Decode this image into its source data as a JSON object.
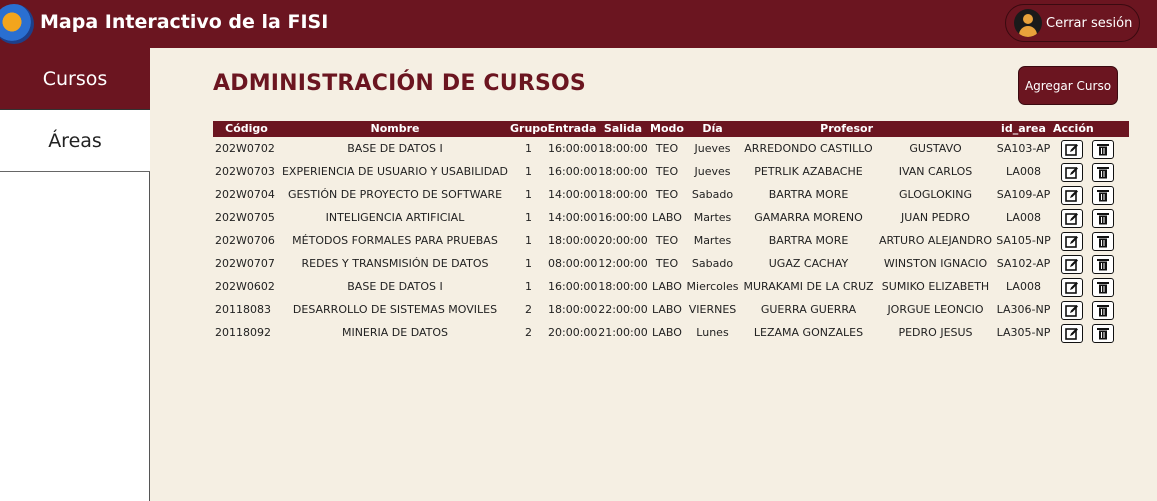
{
  "header": {
    "app_title": "Mapa Interactivo de la FISI",
    "logout_label": "Cerrar sesión"
  },
  "sidebar": {
    "items": [
      {
        "label": "Cursos",
        "active": true
      },
      {
        "label": "Áreas",
        "active": false
      }
    ]
  },
  "main": {
    "title": "ADMINISTRACIÓN DE CURSOS",
    "add_button_label": "Agregar Curso"
  },
  "table": {
    "headers": [
      "Código",
      "Nombre",
      "Grupo",
      "Entrada",
      "Salida",
      "Modo",
      "Día",
      "Profesor",
      "",
      "id_area",
      "Acción"
    ],
    "rows": [
      [
        "202W0702",
        "BASE DE DATOS I",
        "1",
        "16:00:00",
        "18:00:00",
        "TEO",
        "Jueves",
        "ARREDONDO CASTILLO",
        "GUSTAVO",
        "SA103-AP"
      ],
      [
        "202W0703",
        "EXPERIENCIA DE USUARIO Y USABILIDAD",
        "1",
        "16:00:00",
        "18:00:00",
        "TEO",
        "Jueves",
        "PETRLIK AZABACHE",
        "IVAN CARLOS",
        "LA008"
      ],
      [
        "202W0704",
        "GESTIÓN DE PROYECTO DE SOFTWARE",
        "1",
        "14:00:00",
        "18:00:00",
        "TEO",
        "Sabado",
        "BARTRA MORE",
        "GLOGLOKING",
        "SA109-AP"
      ],
      [
        "202W0705",
        "INTELIGENCIA ARTIFICIAL",
        "1",
        "14:00:00",
        "16:00:00",
        "LABO",
        "Martes",
        "GAMARRA MORENO",
        "JUAN PEDRO",
        "LA008"
      ],
      [
        "202W0706",
        "MÉTODOS FORMALES PARA PRUEBAS",
        "1",
        "18:00:00",
        "20:00:00",
        "TEO",
        "Martes",
        "BARTRA MORE",
        "ARTURO ALEJANDRO",
        "SA105-NP"
      ],
      [
        "202W0707",
        "REDES Y TRANSMISIÓN DE DATOS",
        "1",
        "08:00:00",
        "12:00:00",
        "TEO",
        "Sabado",
        "UGAZ CACHAY",
        "WINSTON IGNACIO",
        "SA102-AP"
      ],
      [
        "202W0602",
        "BASE DE DATOS I",
        "1",
        "16:00:00",
        "18:00:00",
        "LABO",
        "Miercoles",
        "MURAKAMI DE LA CRUZ",
        "SUMIKO ELIZABETH",
        "LA008"
      ],
      [
        "20118083",
        "DESARROLLO DE SISTEMAS MOVILES",
        "2",
        "18:00:00",
        "22:00:00",
        "LABO",
        "VIERNES",
        "GUERRA GUERRA",
        "JORGUE LEONCIO",
        "LA306-NP"
      ],
      [
        "20118092",
        "MINERIA DE DATOS",
        "2",
        "20:00:00",
        "21:00:00",
        "LABO",
        "Lunes",
        "LEZAMA GONZALES",
        "PEDRO JESUS",
        "LA305-NP"
      ]
    ]
  },
  "icons": {
    "edit": "edit-icon",
    "delete": "trash-icon",
    "logo": "fisi-logo-icon",
    "avatar": "user-avatar-icon"
  },
  "colors": {
    "brand": "#6b1520",
    "background": "#f5efe3"
  }
}
